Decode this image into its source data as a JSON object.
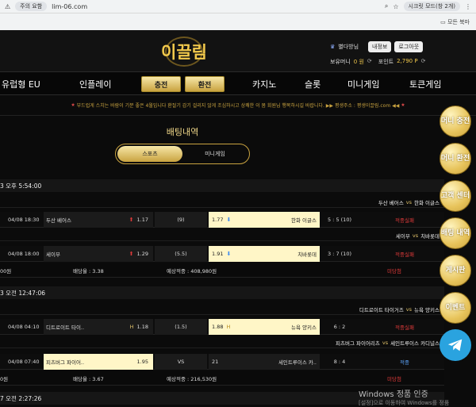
{
  "browser": {
    "notice": "주의 요함",
    "url": "lim-06.com",
    "secret_mode": "시크릿 모드(창 2개)",
    "bookmarks": "모든 북마"
  },
  "header": {
    "logo": "이끌림",
    "user": "별다방님",
    "mypage": "내정보",
    "logout": "로그아웃",
    "cash_label": "보유머니",
    "cash_value": "0 원",
    "point_label": "포인트",
    "point_value": "2,790 P"
  },
  "nav": {
    "eu": "유럽형 EU",
    "inplay": "인플레이",
    "deposit": "충전",
    "withdraw": "환전",
    "casino": "카지노",
    "slot": "슬롯",
    "mini": "미니게임",
    "token": "토큰게임"
  },
  "notice": "부드럽게 스치는 바람이 기분 좋은 4월입니다 환절기 감기 걸리지 않게 조심하시고 상쾌한 이 봄 회원님 행복하시길 바랍니다. ▶▶ 평생주소 : 평생이끌림.com ◀◀",
  "page_title": "배팅내역",
  "tabs": [
    "스포츠",
    "미니게임"
  ],
  "groups": [
    {
      "date": "3 오후 5:54:00",
      "summary": {
        "left": "00원",
        "rate": "배당율 : 3.38",
        "expected": "예상적중 : 408,980원",
        "result": "미당첨"
      },
      "games": [
        {
          "teams": "두산 베어스",
          "vs": "vs",
          "away": "한화 이글스",
          "time": "04/08 18:30",
          "home": "두산 베어스",
          "home_odds": "1.17",
          "line": "(9)",
          "sel_odds": "1.77",
          "away_name": "한화 이글스",
          "score": "5 : 5 (10)",
          "result": "적중실패"
        },
        {
          "teams": "세이부",
          "vs": "vs",
          "away": "치바롯데",
          "time": "04/08 18:00",
          "home": "세이부",
          "home_odds": "1.29",
          "line": "(5.5)",
          "sel_odds": "1.91",
          "away_name": "치바롯데",
          "score": "3 : 7 (10)",
          "result": "적중실패"
        }
      ]
    },
    {
      "date": "3 오전 12:47:06",
      "summary": {
        "left": "0원",
        "rate": "배당율 : 3.67",
        "expected": "예상적중 : 216,530원",
        "result": "미당첨"
      },
      "games": [
        {
          "teams": "디트로이트 타이거즈",
          "vs": "vs",
          "away": "뉴욕 양키스",
          "time": "04/08 04:10",
          "home": "디트로이트 타이..",
          "home_odds": "1.18",
          "line": "(1.5)",
          "sel_odds": "1.88",
          "away_name": "뉴욕 양키스",
          "score": "6 : 2",
          "result": "적중실패"
        },
        {
          "teams": "피츠버그 파이어리츠",
          "vs": "vs",
          "away": "세인트루이스 카디널스",
          "time": "04/08 07:40",
          "home": "피츠버그 파이어..",
          "home_odds": "1.95",
          "line": "VS",
          "sel_odds": "21",
          "away_name": "세인트루이스 카..",
          "score": "8 : 4",
          "result": "적중"
        }
      ]
    }
  ],
  "next_date": "7 오전 2:27:26",
  "sidebar": [
    "머니 충전",
    "머니 환전",
    "고객 센터",
    "배팅 내역",
    "게시판",
    "이벤트"
  ],
  "windows": {
    "line1": "Windows 정품 인증",
    "line2": "[설정]으로 이동하여 Windows를 정품"
  }
}
